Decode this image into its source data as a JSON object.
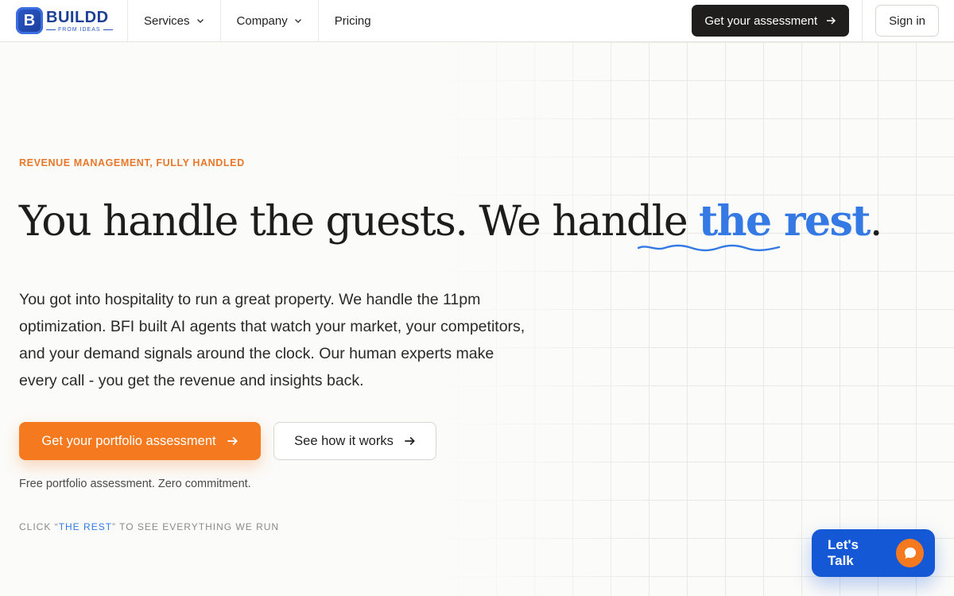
{
  "brand": {
    "badge_letter": "B",
    "name": "BUILDD",
    "tagline": "FROM IDEAS",
    "colors": {
      "primary": "#1d3f95",
      "accent_orange": "#f57a1f",
      "accent_blue": "#2f7ae5"
    }
  },
  "nav": {
    "items": [
      {
        "label": "Services",
        "has_dropdown": true
      },
      {
        "label": "Company",
        "has_dropdown": true
      },
      {
        "label": "Pricing",
        "has_dropdown": false
      }
    ],
    "cta_label": "Get your assessment",
    "signin_label": "Sign in"
  },
  "hero": {
    "eyebrow": "REVENUE MANAGEMENT, FULLY HANDLED",
    "headline_main": "You handle the guests. We handle ",
    "headline_accent": "the rest",
    "headline_end": ".",
    "lede": "You got into hospitality to run a great property. We handle the 11pm optimization. BFI built AI agents that watch your market, your competitors, and your demand signals around the clock. Our human experts make every call - you get the revenue and insights back.",
    "primary_cta": "Get your portfolio assessment",
    "secondary_cta": "See how it works",
    "note": "Free portfolio assessment. Zero commitment.",
    "hint_prefix": "CLICK “",
    "hint_link": "THE REST",
    "hint_suffix": "” TO SEE EVERYTHING WE RUN"
  },
  "chat": {
    "label": "Let's Talk",
    "icon": "chat-bubble-icon"
  }
}
